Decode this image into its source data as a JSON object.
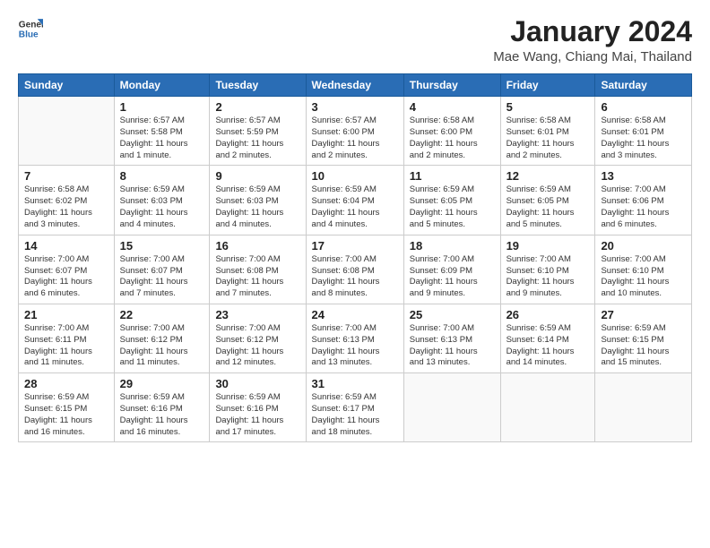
{
  "header": {
    "logo_general": "General",
    "logo_blue": "Blue",
    "title": "January 2024",
    "subtitle": "Mae Wang, Chiang Mai, Thailand"
  },
  "columns": [
    "Sunday",
    "Monday",
    "Tuesday",
    "Wednesday",
    "Thursday",
    "Friday",
    "Saturday"
  ],
  "weeks": [
    [
      {
        "day": "",
        "info": ""
      },
      {
        "day": "1",
        "info": "Sunrise: 6:57 AM\nSunset: 5:58 PM\nDaylight: 11 hours\nand 1 minute."
      },
      {
        "day": "2",
        "info": "Sunrise: 6:57 AM\nSunset: 5:59 PM\nDaylight: 11 hours\nand 2 minutes."
      },
      {
        "day": "3",
        "info": "Sunrise: 6:57 AM\nSunset: 6:00 PM\nDaylight: 11 hours\nand 2 minutes."
      },
      {
        "day": "4",
        "info": "Sunrise: 6:58 AM\nSunset: 6:00 PM\nDaylight: 11 hours\nand 2 minutes."
      },
      {
        "day": "5",
        "info": "Sunrise: 6:58 AM\nSunset: 6:01 PM\nDaylight: 11 hours\nand 2 minutes."
      },
      {
        "day": "6",
        "info": "Sunrise: 6:58 AM\nSunset: 6:01 PM\nDaylight: 11 hours\nand 3 minutes."
      }
    ],
    [
      {
        "day": "7",
        "info": "Sunrise: 6:58 AM\nSunset: 6:02 PM\nDaylight: 11 hours\nand 3 minutes."
      },
      {
        "day": "8",
        "info": "Sunrise: 6:59 AM\nSunset: 6:03 PM\nDaylight: 11 hours\nand 4 minutes."
      },
      {
        "day": "9",
        "info": "Sunrise: 6:59 AM\nSunset: 6:03 PM\nDaylight: 11 hours\nand 4 minutes."
      },
      {
        "day": "10",
        "info": "Sunrise: 6:59 AM\nSunset: 6:04 PM\nDaylight: 11 hours\nand 4 minutes."
      },
      {
        "day": "11",
        "info": "Sunrise: 6:59 AM\nSunset: 6:05 PM\nDaylight: 11 hours\nand 5 minutes."
      },
      {
        "day": "12",
        "info": "Sunrise: 6:59 AM\nSunset: 6:05 PM\nDaylight: 11 hours\nand 5 minutes."
      },
      {
        "day": "13",
        "info": "Sunrise: 7:00 AM\nSunset: 6:06 PM\nDaylight: 11 hours\nand 6 minutes."
      }
    ],
    [
      {
        "day": "14",
        "info": "Sunrise: 7:00 AM\nSunset: 6:07 PM\nDaylight: 11 hours\nand 6 minutes."
      },
      {
        "day": "15",
        "info": "Sunrise: 7:00 AM\nSunset: 6:07 PM\nDaylight: 11 hours\nand 7 minutes."
      },
      {
        "day": "16",
        "info": "Sunrise: 7:00 AM\nSunset: 6:08 PM\nDaylight: 11 hours\nand 7 minutes."
      },
      {
        "day": "17",
        "info": "Sunrise: 7:00 AM\nSunset: 6:08 PM\nDaylight: 11 hours\nand 8 minutes."
      },
      {
        "day": "18",
        "info": "Sunrise: 7:00 AM\nSunset: 6:09 PM\nDaylight: 11 hours\nand 9 minutes."
      },
      {
        "day": "19",
        "info": "Sunrise: 7:00 AM\nSunset: 6:10 PM\nDaylight: 11 hours\nand 9 minutes."
      },
      {
        "day": "20",
        "info": "Sunrise: 7:00 AM\nSunset: 6:10 PM\nDaylight: 11 hours\nand 10 minutes."
      }
    ],
    [
      {
        "day": "21",
        "info": "Sunrise: 7:00 AM\nSunset: 6:11 PM\nDaylight: 11 hours\nand 11 minutes."
      },
      {
        "day": "22",
        "info": "Sunrise: 7:00 AM\nSunset: 6:12 PM\nDaylight: 11 hours\nand 11 minutes."
      },
      {
        "day": "23",
        "info": "Sunrise: 7:00 AM\nSunset: 6:12 PM\nDaylight: 11 hours\nand 12 minutes."
      },
      {
        "day": "24",
        "info": "Sunrise: 7:00 AM\nSunset: 6:13 PM\nDaylight: 11 hours\nand 13 minutes."
      },
      {
        "day": "25",
        "info": "Sunrise: 7:00 AM\nSunset: 6:13 PM\nDaylight: 11 hours\nand 13 minutes."
      },
      {
        "day": "26",
        "info": "Sunrise: 6:59 AM\nSunset: 6:14 PM\nDaylight: 11 hours\nand 14 minutes."
      },
      {
        "day": "27",
        "info": "Sunrise: 6:59 AM\nSunset: 6:15 PM\nDaylight: 11 hours\nand 15 minutes."
      }
    ],
    [
      {
        "day": "28",
        "info": "Sunrise: 6:59 AM\nSunset: 6:15 PM\nDaylight: 11 hours\nand 16 minutes."
      },
      {
        "day": "29",
        "info": "Sunrise: 6:59 AM\nSunset: 6:16 PM\nDaylight: 11 hours\nand 16 minutes."
      },
      {
        "day": "30",
        "info": "Sunrise: 6:59 AM\nSunset: 6:16 PM\nDaylight: 11 hours\nand 17 minutes."
      },
      {
        "day": "31",
        "info": "Sunrise: 6:59 AM\nSunset: 6:17 PM\nDaylight: 11 hours\nand 18 minutes."
      },
      {
        "day": "",
        "info": ""
      },
      {
        "day": "",
        "info": ""
      },
      {
        "day": "",
        "info": ""
      }
    ]
  ]
}
